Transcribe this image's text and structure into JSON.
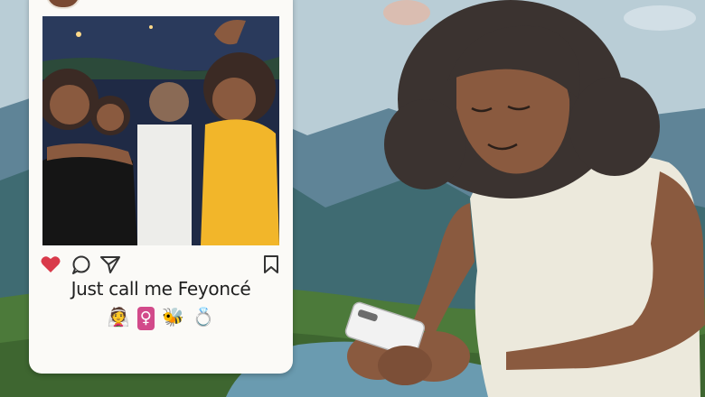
{
  "post": {
    "caption": "Just call me Feyoncé",
    "emojis": [
      "👰",
      "♀",
      "🐝",
      "💍"
    ],
    "liked": true,
    "icons": [
      "heart-icon",
      "comment-icon",
      "share-icon",
      "bookmark-icon"
    ]
  },
  "colors": {
    "sky": "#b9cdd6",
    "mountain_far": "#5f8497",
    "mountain_near": "#3f6b72",
    "grass": "#4c7a3a",
    "card": "#fbfaf7",
    "heart": "#d93a4a",
    "jeans": "#6a9bb0",
    "tank_top": "#ece9dc",
    "skin": "#8a5a3f",
    "hair": "#3b3330"
  }
}
